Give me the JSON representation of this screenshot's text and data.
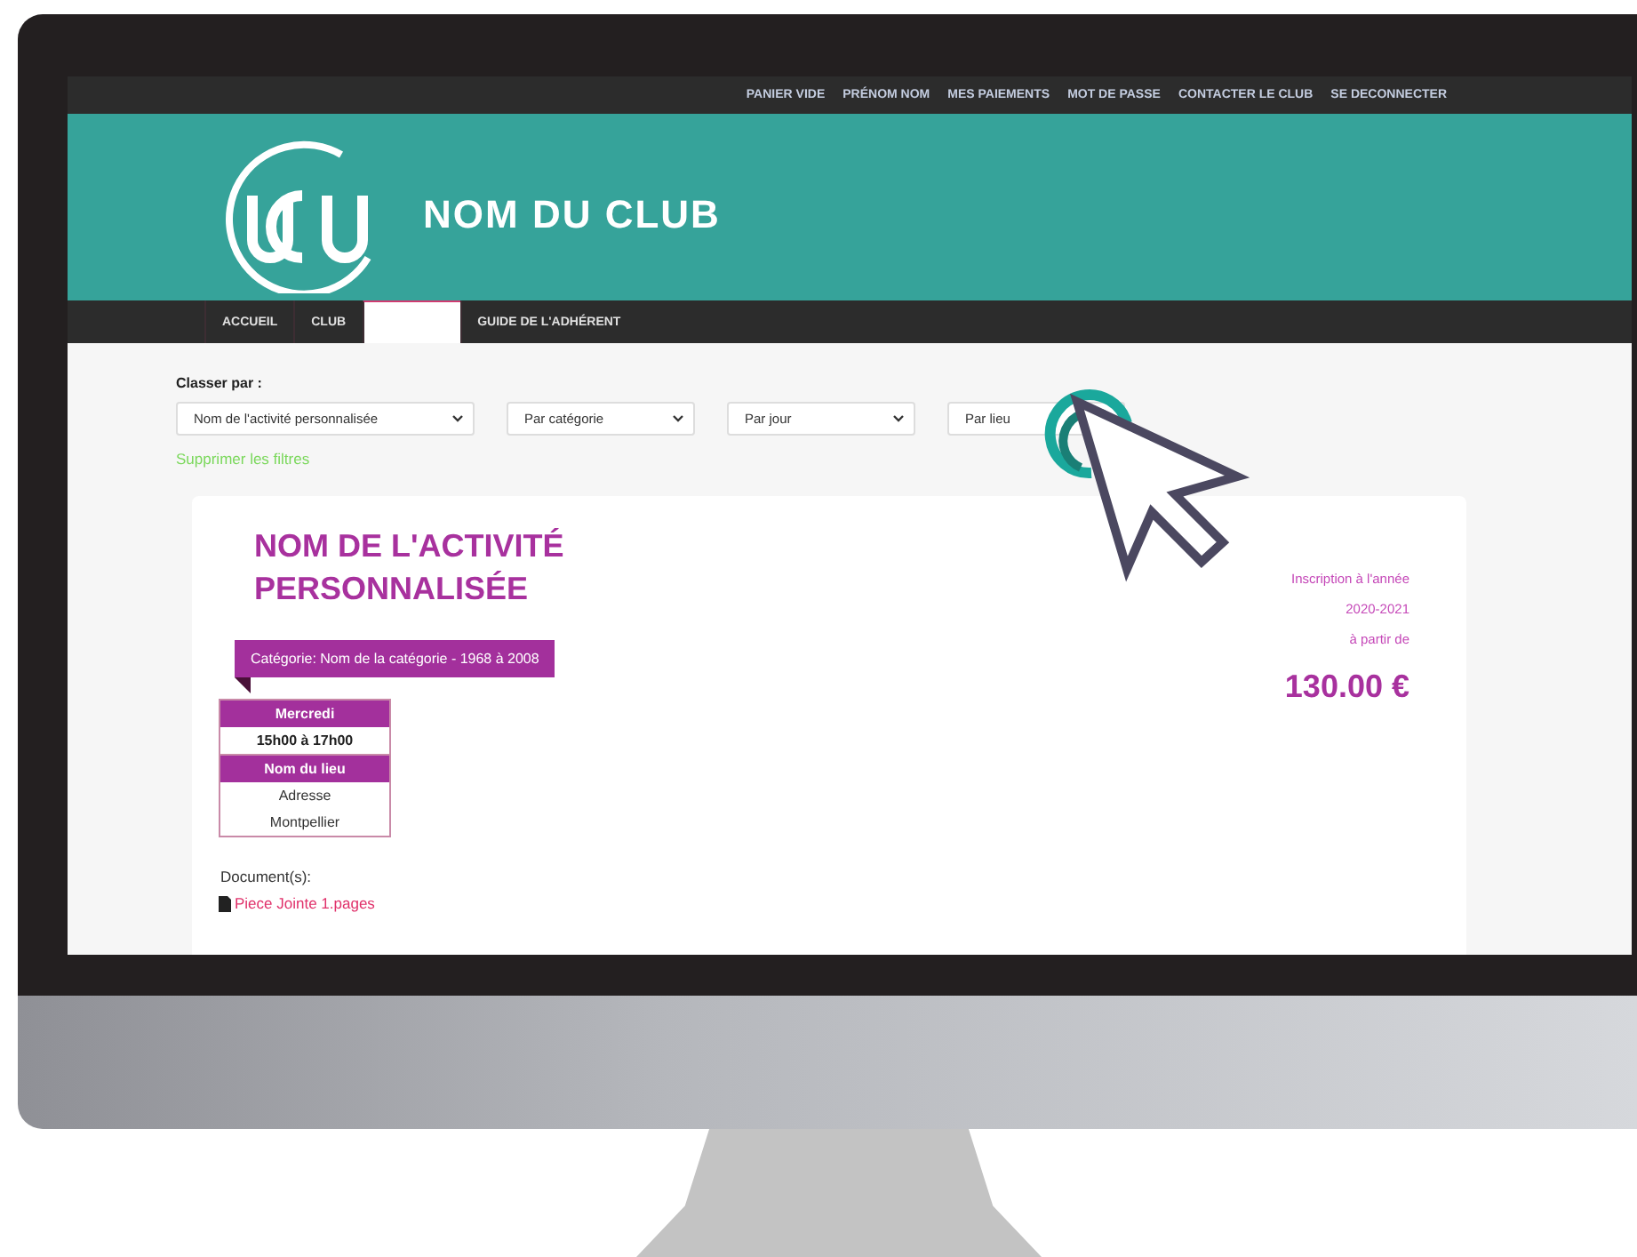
{
  "top_links": [
    "PANIER VIDE",
    "PRÉNOM NOM",
    "MES PAIEMENTS",
    "MOT DE PASSE",
    "CONTACTER LE CLUB",
    "SE DECONNECTER"
  ],
  "header": {
    "club_name": "NOM DU CLUB"
  },
  "nav": [
    {
      "label": "ACCUEIL",
      "selected": false
    },
    {
      "label": "CLUB",
      "selected": false
    },
    {
      "selected": true
    },
    {
      "label": "GUIDE DE L'ADHÉRENT",
      "selected": false
    }
  ],
  "filters": {
    "label": "Classer par :",
    "selects": [
      "Nom de l'activité personnalisée",
      "Par catégorie",
      "Par jour",
      "Par lieu"
    ],
    "clear_link": "Supprimer les filtres"
  },
  "activity": {
    "title": "NOM DE L'ACTIVITÉ PERSONNALISÉE",
    "price_notes": [
      "Inscription à l'année",
      "2020-2021",
      "à partir de"
    ],
    "price": "130.00 €",
    "category": "Catégorie: Nom de la catégorie - 1968 à 2008",
    "schedule": [
      {
        "kind": "heading",
        "text": "Mercredi"
      },
      {
        "kind": "strong",
        "text": "15h00 à 17h00"
      },
      {
        "kind": "heading",
        "text": "Nom du lieu"
      },
      {
        "kind": "plain",
        "text": "Adresse"
      },
      {
        "kind": "plain",
        "text": "Montpellier"
      }
    ],
    "documents_label": "Document(s):",
    "documents": [
      "Piece Jointe 1.pages"
    ]
  }
}
